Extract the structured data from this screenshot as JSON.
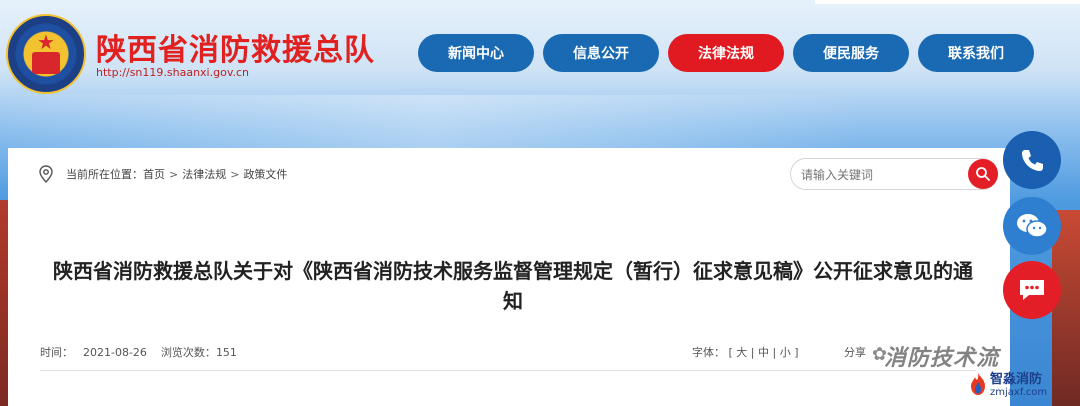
{
  "site": {
    "title": "陕西省消防救援总队",
    "url": "http://sn119.shaanxi.gov.cn"
  },
  "nav": [
    {
      "label": "新闻中心",
      "active": false
    },
    {
      "label": "信息公开",
      "active": false
    },
    {
      "label": "法律法规",
      "active": true
    },
    {
      "label": "便民服务",
      "active": false
    },
    {
      "label": "联系我们",
      "active": false
    }
  ],
  "breadcrumb": {
    "prefix": "当前所在位置：",
    "items": [
      "首页",
      "法律法规",
      "政策文件"
    ],
    "separator": ">"
  },
  "search": {
    "placeholder": "请输入关键词"
  },
  "article": {
    "title": "陕西省消防救援总队关于对《陕西省消防技术服务监督管理规定（暂行）征求意见稿》公开征求意见的通知",
    "time_label": "时间：",
    "time": "2021-08-26",
    "views_label": "浏览次数：",
    "views": "151",
    "font_label": "字体：",
    "font_sizes": [
      "大",
      "中",
      "小"
    ],
    "share_label": "分享"
  },
  "watermark": {
    "channel": "消防技术流",
    "logo_title": "智淼消防",
    "logo_url": "zmjaxf.com"
  },
  "colors": {
    "brand_red": "#e01a20",
    "nav_blue": "#1a6ab3",
    "float_blue": "#1a5fb0",
    "float_light_blue": "#2e7fd0"
  },
  "icons": {
    "floating": [
      "phone-icon",
      "wechat-icon",
      "chat-icon"
    ],
    "search": "search-icon",
    "location": "location-pin-icon"
  }
}
